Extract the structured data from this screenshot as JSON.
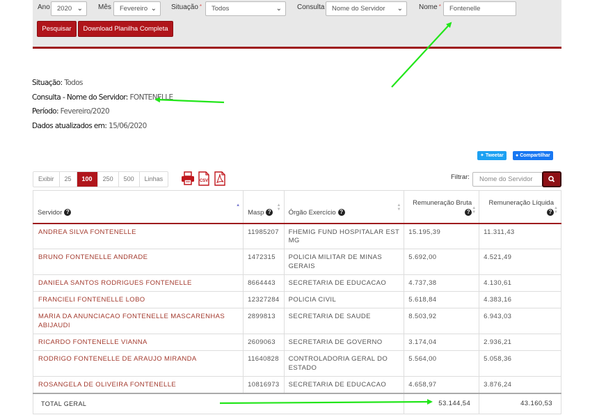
{
  "filters": {
    "ano": {
      "label": "Ano",
      "value": "2020"
    },
    "mes": {
      "label": "Mês",
      "value": "Fevereiro"
    },
    "situacao": {
      "label": "Situação",
      "value": "Todos"
    },
    "consulta": {
      "label": "Consulta",
      "value": "Nome do Servidor"
    },
    "nome": {
      "label": "Nome",
      "value": "Fontenelle"
    },
    "required_mark": "*",
    "pesquisar_label": "Pesquisar",
    "download_label": "Download Planilha Completa"
  },
  "info": {
    "situacao_key": "Situação:",
    "situacao_val": "Todos",
    "consulta_key": "Consulta - Nome do Servidor:",
    "consulta_val": "FONTENELLE",
    "periodo_key": "Período:",
    "periodo_val": "Fevereiro/2020",
    "dados_key": "Dados atualizados em:",
    "dados_val": "15/06/2020"
  },
  "share": {
    "tweet": "Tweetar",
    "facebook": "Compartilhar"
  },
  "pager": {
    "exibir": "Exibir",
    "options": [
      "25",
      "100",
      "250",
      "500"
    ],
    "active": "100",
    "linhas": "Linhas"
  },
  "exports": {
    "print_icon": "printer-icon",
    "csv_label": "CSV",
    "pdf_label": "PDF"
  },
  "search": {
    "label": "Filtrar:",
    "placeholder": "Nome do Servidor"
  },
  "table": {
    "headers": [
      "Servidor",
      "Masp",
      "Órgão Exercício",
      "Remuneração Bruta",
      "Remuneração Líquida"
    ],
    "rows": [
      {
        "servidor": "ANDREA SILVA FONTENELLE",
        "masp": "11985207",
        "orgao": "FHEMIG FUND HOSPITALAR EST MG",
        "bruta": "15.195,39",
        "liquida": "11.311,43"
      },
      {
        "servidor": "BRUNO FONTENELLE ANDRADE",
        "masp": "1472315",
        "orgao": "POLICIA MILITAR DE MINAS GERAIS",
        "bruta": "5.692,00",
        "liquida": "4.521,49"
      },
      {
        "servidor": "DANIELA SANTOS RODRIGUES FONTENELLE",
        "masp": "8664443",
        "orgao": "SECRETARIA DE EDUCACAO",
        "bruta": "4.737,38",
        "liquida": "4.130,61"
      },
      {
        "servidor": "FRANCIELI FONTENELLE LOBO",
        "masp": "12327284",
        "orgao": "POLICIA CIVIL",
        "bruta": "5.618,84",
        "liquida": "4.383,16"
      },
      {
        "servidor": "MARIA DA ANUNCIACAO FONTENELLE MASCARENHAS ABIJAUDI",
        "masp": "2899813",
        "orgao": "SECRETARIA DE SAUDE",
        "bruta": "8.503,92",
        "liquida": "6.943,03"
      },
      {
        "servidor": "RICARDO FONTENELLE VIANNA",
        "masp": "2609063",
        "orgao": "SECRETARIA DE GOVERNO",
        "bruta": "3.174,04",
        "liquida": "2.936,21"
      },
      {
        "servidor": "RODRIGO FONTENELLE DE ARAUJO MIRANDA",
        "masp": "11640828",
        "orgao": "CONTROLADORIA GERAL DO ESTADO",
        "bruta": "5.564,00",
        "liquida": "5.058,36"
      },
      {
        "servidor": "ROSANGELA DE OLIVEIRA FONTENELLE",
        "masp": "10816973",
        "orgao": "SECRETARIA DE EDUCACAO",
        "bruta": "4.658,97",
        "liquida": "3.876,24"
      }
    ],
    "total_label": "TOTAL GERAL",
    "total_bruta": "53.144,54",
    "total_liquida": "43.160,53"
  },
  "colors": {
    "brand_red": "#b0151b",
    "annotation_arrow": "#22e61a",
    "link_name": "#a33a2e"
  }
}
